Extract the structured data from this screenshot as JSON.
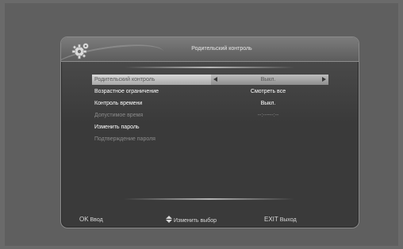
{
  "header": {
    "title": "Родительский контроль"
  },
  "menu": {
    "items": [
      {
        "label": "Родительский контроль",
        "value": "Выкл."
      },
      {
        "label": "Возрастное ограничение",
        "value": "Смотреть все"
      },
      {
        "label": "Контроль времени",
        "value": "Выкл."
      },
      {
        "label": "Допустимое время",
        "value": "--:--~--:--"
      },
      {
        "label": "Изменить пароль",
        "value": ""
      },
      {
        "label": "Подтверждение пароля",
        "value": ""
      }
    ]
  },
  "footer": {
    "ok_key": "OK",
    "ok_label": "Ввод",
    "nav_label": "Изменить выбор",
    "exit_key": "EXIT",
    "exit_label": "Выход"
  },
  "colors": {
    "background": "#6a6a6a",
    "panel": "#3a3a3a",
    "highlight": "#c8c8c8",
    "disabled_text": "#8b8b8b"
  }
}
